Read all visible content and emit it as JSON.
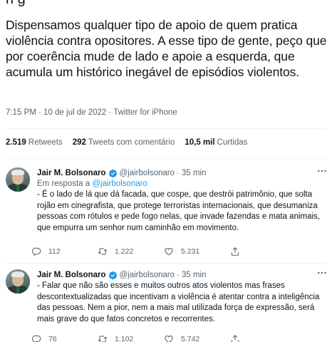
{
  "tweet": {
    "cut_top_text": "ri g",
    "text": "Dispensamos qualquer tipo de apoio de quem pratica violência contra opositores. A esse tipo de gente, peço que por coerência mude de lado e apoie a esquerda, que acumula um histórico inegável de episódios violentos.",
    "meta": "7:15 PM · 10 de jul de 2022 · Twitter for iPhone"
  },
  "stats": {
    "retweets_count": "2.519",
    "retweets_label": "Retweets",
    "quotes_count": "292",
    "quotes_label": "Tweets com comentário",
    "likes_count": "10,5 mil",
    "likes_label": "Curtidas"
  },
  "replies": [
    {
      "name": "Jair M. Bolsonaro",
      "handle": "@jairbolsonaro",
      "time": "35 min",
      "replying_prefix": "Em resposta a",
      "replying_handle": "@jairbolsonaro",
      "text": "- É o lado de lá que dá facada, que cospe, que destrói patrimônio, que solta rojão em cinegrafista, que protege terroristas internacionais, que desumaniza pessoas com rótulos e pede fogo nelas, que invade fazendas e mata animais, que empurra um senhor num caminhão em movimento.",
      "replies": "112",
      "retweets": "1.222",
      "likes": "5.231"
    },
    {
      "name": "Jair M. Bolsonaro",
      "handle": "@jairbolsonaro",
      "time": "35 min",
      "text": "- Falar que não são esses e muitos outros atos violentos mas frases descontextualizadas que incentivam a violência é atentar contra a inteligência das pessoas. Nem a pior, nem a mais mal utilizada força de expressão, será mais grave do que fatos concretos e recorrentes.",
      "replies": "76",
      "retweets": "1.102",
      "likes": "5.742"
    }
  ],
  "colors": {
    "accent": "#1d9bf0",
    "text": "#0f1419",
    "muted": "#536471",
    "divider": "#eff3f4"
  },
  "icons": [
    "verified-badge-icon",
    "more-icon",
    "reply-icon",
    "retweet-icon",
    "like-icon",
    "share-icon"
  ]
}
